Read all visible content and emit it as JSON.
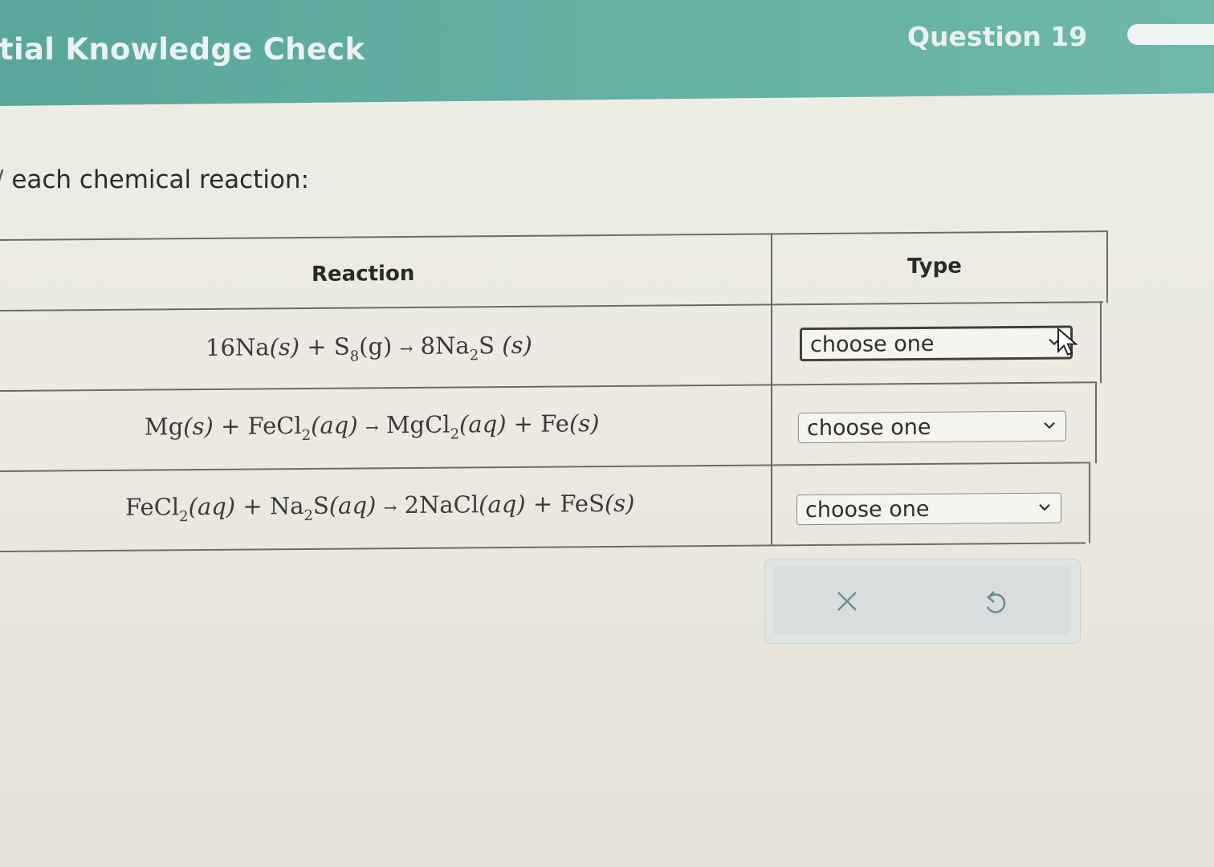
{
  "header": {
    "title": "itial Knowledge Check",
    "question_label": "Question 19"
  },
  "instruction": "each chemical reaction:",
  "table": {
    "columns": [
      "Reaction",
      "Type"
    ],
    "rows": [
      {
        "reaction": {
          "coef1": "16Na",
          "st1": "(s)",
          "plus": "+",
          "s8": "S",
          "s8sub": "8",
          "st2": "(g)",
          "arrow": "→",
          "prod": "8Na",
          "prodsub": "2",
          "prod2": "S",
          "st3": "(s)"
        },
        "type_value": "choose one"
      },
      {
        "reaction": {
          "r1": "Mg",
          "st1": "(s)",
          "plus1": "+",
          "r2": "FeCl",
          "r2sub": "2",
          "st2": "(aq)",
          "arrow": "→",
          "p1": "MgCl",
          "p1sub": "2",
          "st3": "(aq)",
          "plus2": "+",
          "p2": "Fe",
          "st4": "(s)"
        },
        "type_value": "choose one"
      },
      {
        "reaction": {
          "r1": "FeCl",
          "r1sub": "2",
          "st1": "(aq)",
          "plus1": "+",
          "r2": "Na",
          "r2sub": "2",
          "r2b": "S",
          "st2": "(aq)",
          "arrow": "→",
          "p1": "2NaCl",
          "st3": "(aq)",
          "plus2": "+",
          "p2": "FeS",
          "st4": "(s)"
        },
        "type_value": "choose one"
      }
    ]
  },
  "actions": {
    "clear_icon": "close-icon",
    "undo_icon": "undo-icon"
  },
  "colors": {
    "header_bg": "#5aa69a",
    "page_bg": "#eceae1",
    "text": "#2b2b2b",
    "grid": "#6b6b6b"
  }
}
